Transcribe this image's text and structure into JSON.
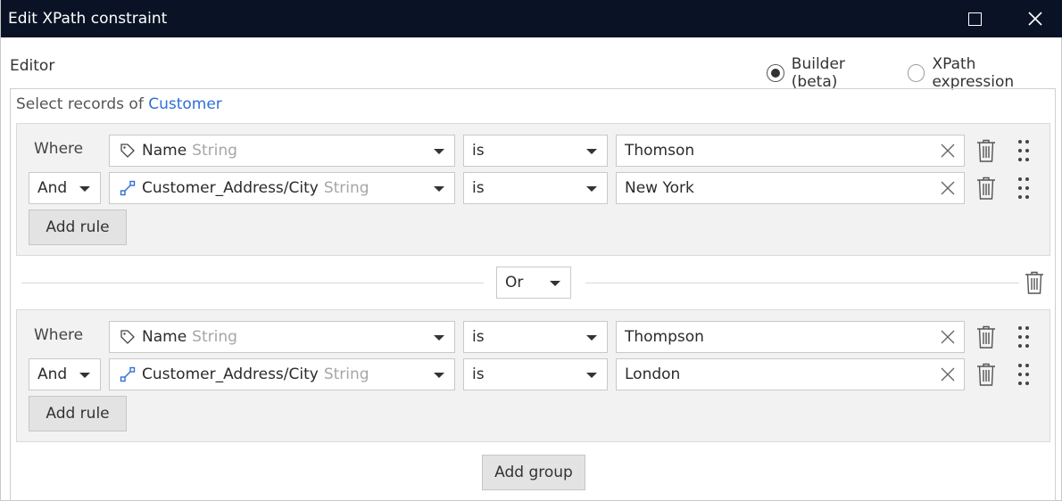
{
  "window": {
    "title": "Edit XPath constraint"
  },
  "editor": {
    "label": "Editor",
    "modes": [
      {
        "label": "Builder (beta)",
        "selected": true
      },
      {
        "label": "XPath expression",
        "selected": false
      }
    ]
  },
  "builder": {
    "select_prefix": "Select records of",
    "entity": "Customer",
    "groups": [
      {
        "rules": [
          {
            "connector": "Where",
            "attribute": "Name",
            "type": "String",
            "attr_icon": "tag-icon",
            "operator": "is",
            "value": "Thomson"
          },
          {
            "connector": "And",
            "attribute": "Customer_Address/City",
            "type": "String",
            "attr_icon": "association-icon",
            "operator": "is",
            "value": "New York"
          }
        ],
        "add_rule_label": "Add rule"
      },
      {
        "rules": [
          {
            "connector": "Where",
            "attribute": "Name",
            "type": "String",
            "attr_icon": "tag-icon",
            "operator": "is",
            "value": "Thompson"
          },
          {
            "connector": "And",
            "attribute": "Customer_Address/City",
            "type": "String",
            "attr_icon": "association-icon",
            "operator": "is",
            "value": "London"
          }
        ],
        "add_rule_label": "Add rule"
      }
    ],
    "group_connector": "Or",
    "add_group_label": "Add group"
  },
  "colors": {
    "titlebar": "#0a1326",
    "link": "#2f6fd6",
    "type_hint": "#a6a6a6",
    "group_bg": "#f2f2f2"
  }
}
